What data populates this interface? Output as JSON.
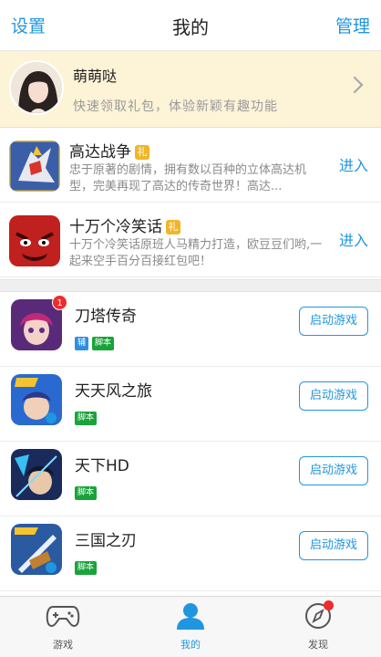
{
  "header": {
    "left_label": "设置",
    "title": "我的",
    "right_label": "管理"
  },
  "profile": {
    "name": "萌萌哒",
    "subtitle": "快速领取礼包，体验新颖有趣功能"
  },
  "promos": [
    {
      "title": "高达战争",
      "gift_label": "礼",
      "desc": "忠于原著的剧情，拥有数以百种的立体高达机型，完美再现了高达的传奇世界！高达...",
      "action": "进入",
      "icon": "gundam-icon"
    },
    {
      "title": "十万个冷笑话",
      "gift_label": "礼",
      "desc": "十万个冷笑话原班人马精力打造，欧豆豆们哟,一起来空手百分百接红包吧！",
      "action": "进入",
      "icon": "red-face-icon"
    }
  ],
  "games": [
    {
      "name": "刀塔传奇",
      "badge": "1",
      "tags": [
        "辅",
        "脚本"
      ],
      "button": "启动游戏"
    },
    {
      "name": "天天风之旅",
      "badge": "",
      "tags": [
        "脚本"
      ],
      "button": "启动游戏"
    },
    {
      "name": "天下HD",
      "badge": "",
      "tags": [
        "脚本"
      ],
      "button": "启动游戏"
    },
    {
      "name": "三国之刃",
      "badge": "",
      "tags": [
        "脚本"
      ],
      "button": "启动游戏"
    }
  ],
  "tabbar": {
    "tabs": [
      {
        "label": "游戏",
        "icon": "gamepad-icon"
      },
      {
        "label": "我的",
        "icon": "user-icon",
        "active": true
      },
      {
        "label": "发现",
        "icon": "compass-icon"
      }
    ]
  },
  "colors": {
    "accent": "#2196e0",
    "profile_bg": "#fdf3d7",
    "gift_tag": "#f0b628",
    "script_tag": "#1aa33a",
    "assist_tag": "#2e8fe0",
    "badge": "#ee2b2b"
  }
}
